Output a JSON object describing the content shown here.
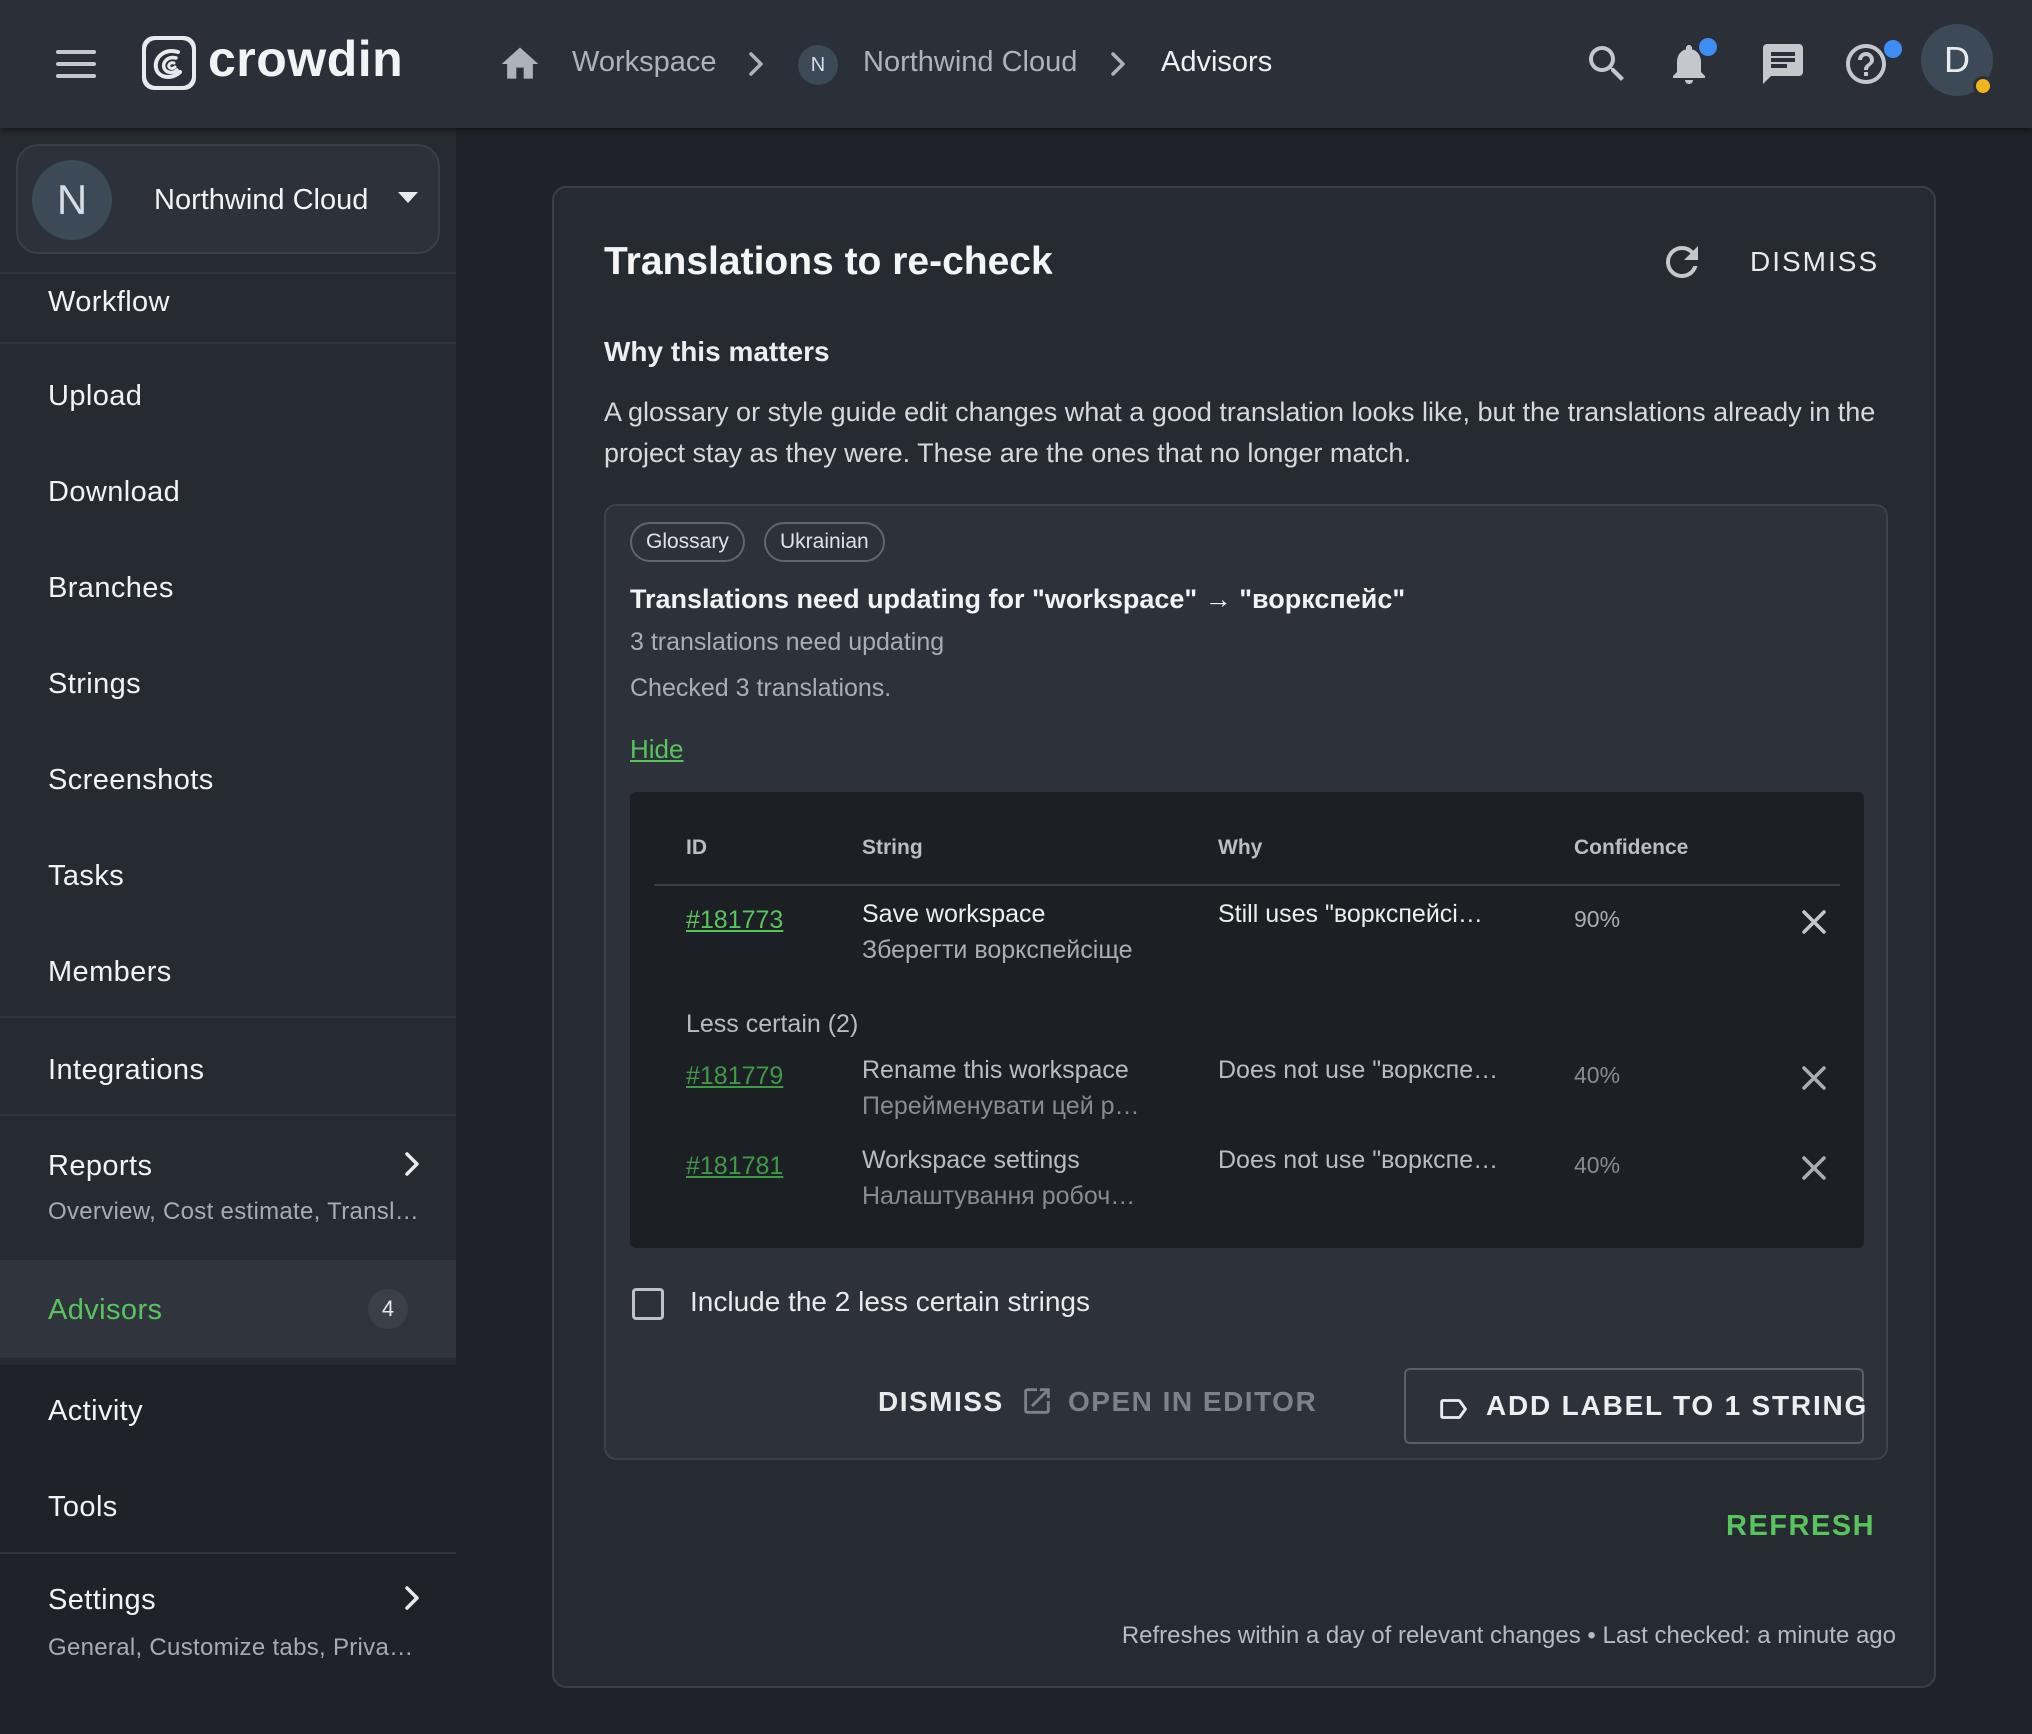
{
  "app": {
    "logo_text": "crowdin",
    "colors": {
      "accent": "#58c45e",
      "notification_dot": "#3d8ef2",
      "status_away": "#f2b51c",
      "background": "#1e2127"
    }
  },
  "header": {
    "breadcrumb": {
      "workspace": "Workspace",
      "org_initial": "N",
      "org": "Northwind Cloud",
      "current": "Advisors"
    },
    "icons": [
      "menu-icon",
      "home-icon",
      "search-icon",
      "bell-icon",
      "chat-icon",
      "help-icon"
    ],
    "avatar_initial": "D"
  },
  "sidebar": {
    "org": {
      "initial": "N",
      "name": "Northwind Cloud"
    },
    "items": [
      {
        "label": "Workflow"
      },
      {
        "label": "Upload"
      },
      {
        "label": "Download"
      },
      {
        "label": "Branches"
      },
      {
        "label": "Strings"
      },
      {
        "label": "Screenshots"
      },
      {
        "label": "Tasks"
      },
      {
        "label": "Members"
      },
      {
        "label": "Integrations"
      },
      {
        "label": "Reports",
        "sub": "Overview, Cost estimate, Transl…"
      },
      {
        "label": "Advisors",
        "badge": "4",
        "active": true
      },
      {
        "label": "Activity"
      },
      {
        "label": "Tools"
      },
      {
        "label": "Settings",
        "sub": "General, Customize tabs, Priva…"
      }
    ]
  },
  "card": {
    "title": "Translations to re-check",
    "dismiss_label": "DISMISS",
    "why_heading": "Why this matters",
    "why_text": "A glossary or style guide edit changes what a good translation looks like, but the translations already in the project stay as they were. These are the ones that no longer match.",
    "finding": {
      "tags": [
        "Glossary",
        "Ukrainian"
      ],
      "title": "Translations need updating for \"workspace\" → \"воркспейс\"",
      "subtitle": "3 translations need updating",
      "checked": "Checked 3 translations.",
      "hide_label": "Hide",
      "columns": {
        "id": "ID",
        "string": "String",
        "why": "Why",
        "confidence": "Confidence"
      },
      "rows": [
        {
          "id": "#181773",
          "string": "Save workspace",
          "translation": "Зберегти воркспейсіще",
          "why": "Still uses \"воркспейсі…",
          "confidence": "90%"
        },
        {
          "id": "#181779",
          "string": "Rename this workspace",
          "translation": "Перейменувати цей р…",
          "why": "Does not use \"воркспе…",
          "confidence": "40%"
        },
        {
          "id": "#181781",
          "string": "Workspace settings",
          "translation": "Налаштування робоч…",
          "why": "Does not use \"воркспе…",
          "confidence": "40%"
        }
      ],
      "less_certain_label": "Less certain (2)",
      "include_label": "Include the 2 less certain strings",
      "actions": {
        "dismiss": "DISMISS",
        "open_editor": "OPEN IN EDITOR",
        "add_label": "ADD LABEL TO 1 STRING"
      }
    },
    "refresh_label": "REFRESH",
    "footnote": "Refreshes within a day of relevant changes • Last checked: a minute ago"
  }
}
